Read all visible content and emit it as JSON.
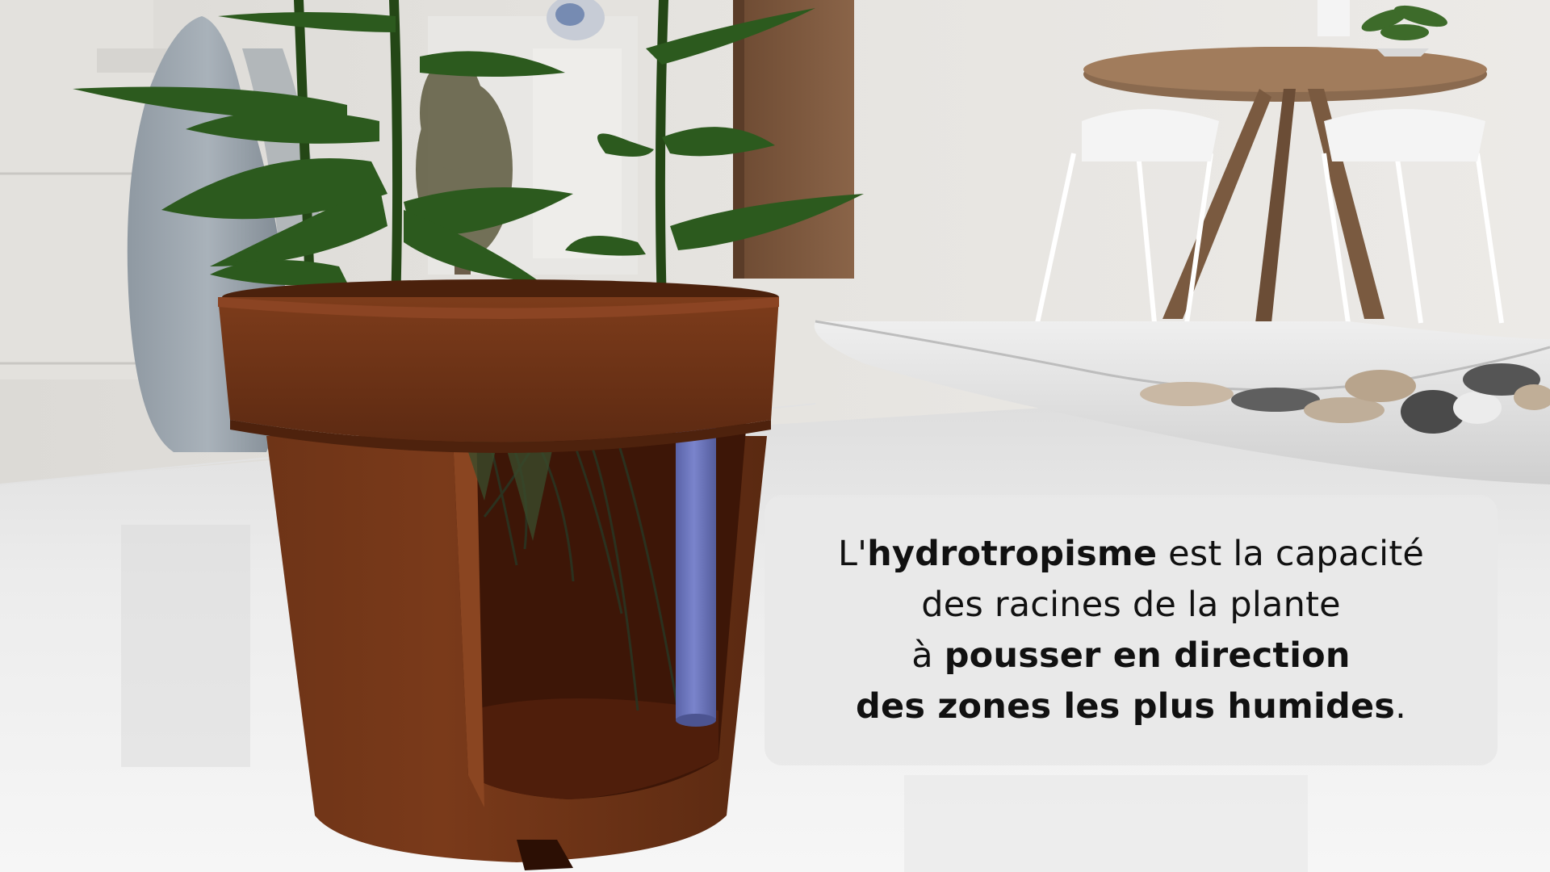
{
  "caption": {
    "line1": {
      "prefix": "L'",
      "bold": "hydrotropisme",
      "suffix": " est la capacité"
    },
    "line2": {
      "text": "des racines de la plante"
    },
    "line3": {
      "prefix": "à ",
      "bold": "pousser en direction"
    },
    "line4": {
      "bold": "des zones les plus humides",
      "suffix": "."
    }
  },
  "colors": {
    "pot": "#6b3216",
    "pot_interior": "#3a1506",
    "water_tube": "#6f79c4",
    "leaf": "#2c5a1e",
    "table": "#f1f1f1",
    "caption_background": "#e8e8e8"
  }
}
